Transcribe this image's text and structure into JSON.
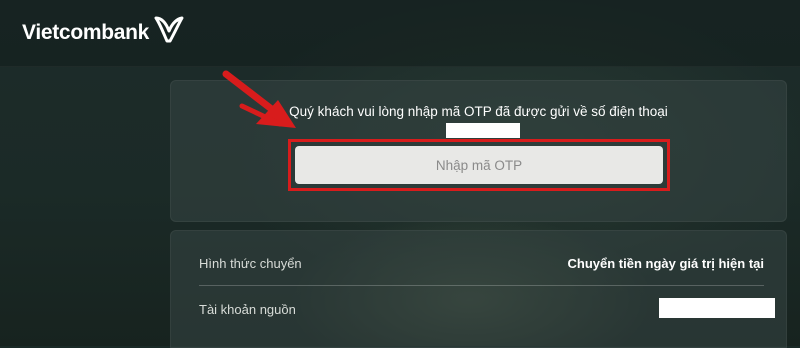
{
  "brand": {
    "name": "Vietcombank",
    "logo_icon": "vietcombank-v-icon",
    "color": "#1a9b3a"
  },
  "otp": {
    "message": "Quý khách vui lòng nhập mã OTP đã được gửi về số điện thoại",
    "placeholder": "Nhập mã OTP",
    "highlight_color": "#d81c1c",
    "arrow_icon": "red-arrow-icon"
  },
  "details": {
    "rows": [
      {
        "label": "Hình thức chuyển",
        "value": "Chuyển tiền ngày giá trị hiện tại"
      },
      {
        "label": "Tài khoản nguồn",
        "value": ""
      }
    ]
  }
}
